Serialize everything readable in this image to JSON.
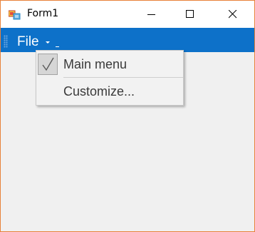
{
  "window": {
    "title": "Form1",
    "icon": "winforms-app-icon",
    "controls": [
      "minimize-icon",
      "maximize-icon",
      "close-icon"
    ]
  },
  "toolstrip": {
    "background": "#0d71c9",
    "items": [
      {
        "label": "File",
        "icon": "chevron-down-icon"
      }
    ]
  },
  "dropdown": {
    "items": [
      {
        "label": "Main menu",
        "checked": true,
        "icon": "checkmark-icon"
      },
      {
        "label": "Customize..."
      }
    ]
  },
  "colors": {
    "window_border": "#e8823a",
    "client_background": "#f0f0f0",
    "menu_background": "#f2f2f2"
  }
}
